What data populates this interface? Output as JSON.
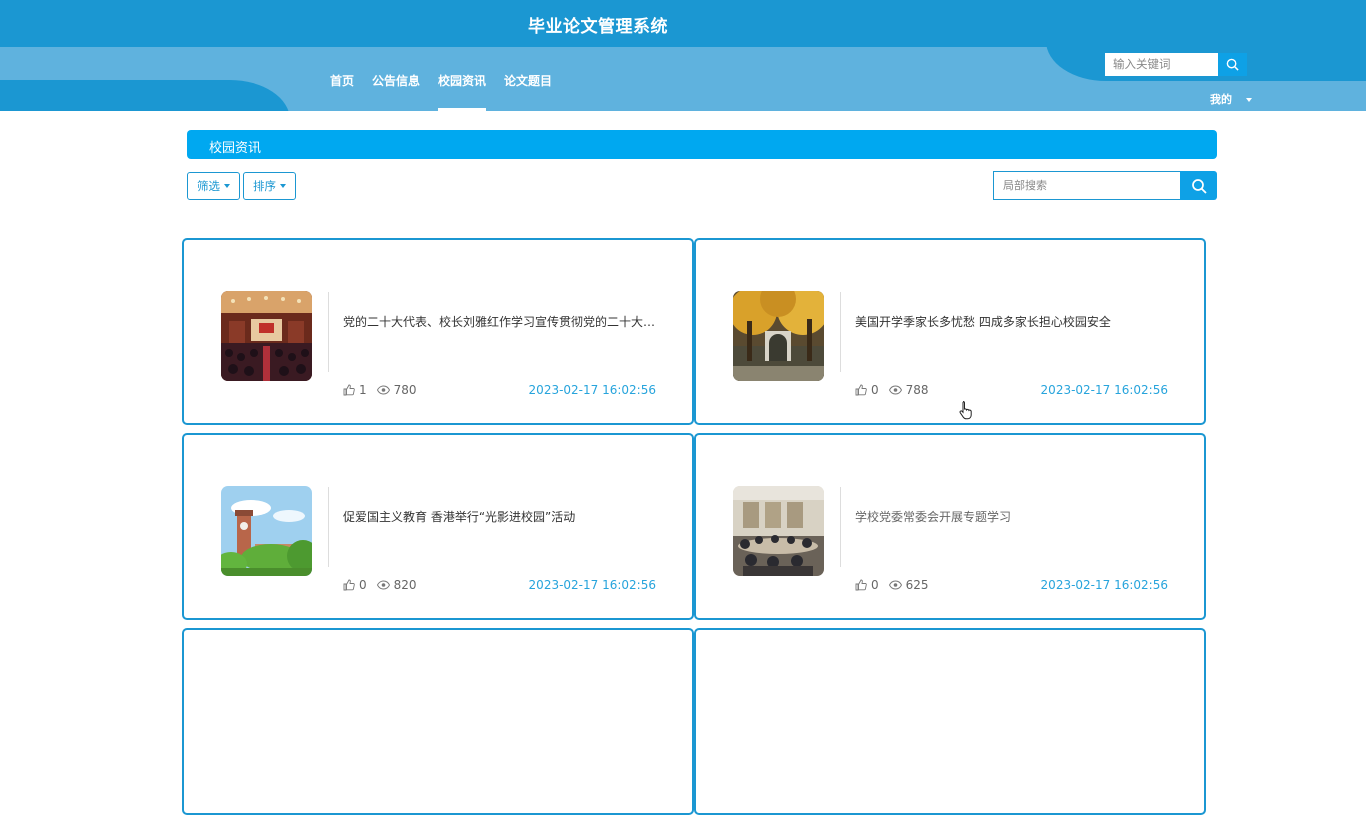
{
  "header": {
    "title": "毕业论文管理系统",
    "nav": [
      "首页",
      "公告信息",
      "校园资讯",
      "论文题目"
    ],
    "active_nav": "校园资讯",
    "search_placeholder": "输入关键词",
    "user_menu": "我的"
  },
  "section": {
    "title": "校园资讯",
    "filter_label": "筛选",
    "sort_label": "排序",
    "search_placeholder": "局部搜索"
  },
  "colors": {
    "primary": "#1b97d2",
    "accent": "#00a8f0",
    "time": "#27a4dc"
  },
  "cards": [
    {
      "title": "党的二十大代表、校长刘雅红作学习宣传贯彻党的二十大精神宣讲报告",
      "likes": "1",
      "views": "780",
      "time": "2023-02-17 16:02:56",
      "image": "auditorium-photo"
    },
    {
      "title": "美国开学季家长多忧愁 四成多家长担心校园安全",
      "likes": "0",
      "views": "788",
      "time": "2023-02-17 16:02:56",
      "image": "autumn-trees-gate-photo"
    },
    {
      "title": "促爱国主义教育 香港举行“光影进校园”活动",
      "likes": "0",
      "views": "820",
      "time": "2023-02-17 16:02:56",
      "image": "clock-tower-photo"
    },
    {
      "title": "学校党委常委会开展专题学习",
      "likes": "0",
      "views": "625",
      "time": "2023-02-17 16:02:56",
      "image": "meeting-room-photo"
    }
  ]
}
